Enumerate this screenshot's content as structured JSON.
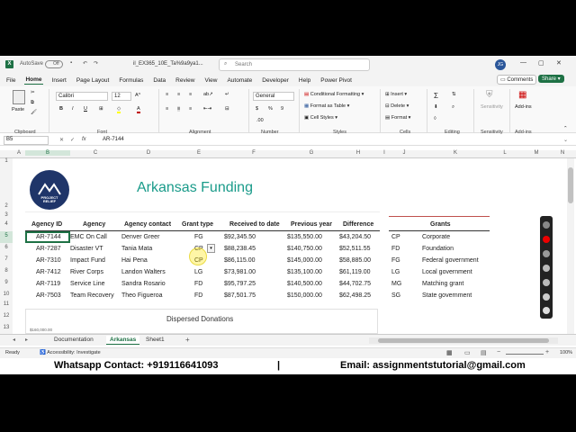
{
  "app": {
    "autosave": "AutoSave",
    "autosave_state": "Off",
    "filename": "il_EX365_10E_Ta%9a9ya1...",
    "search_placeholder": "Search",
    "user_initials": "JG"
  },
  "menu": [
    "File",
    "Home",
    "Insert",
    "Page Layout",
    "Formulas",
    "Data",
    "Review",
    "View",
    "Automate",
    "Developer",
    "Help",
    "Power Pivot"
  ],
  "menu_active": "Home",
  "actions": {
    "comments": "Comments",
    "share": "Share"
  },
  "ribbon": {
    "clipboard": {
      "paste": "Paste",
      "label": "Clipboard"
    },
    "font": {
      "name": "Calibri",
      "size": "12",
      "label": "Font"
    },
    "alignment": {
      "label": "Alignment"
    },
    "number": {
      "format": "General",
      "label": "Number"
    },
    "styles": {
      "conditional": "Conditional Formatting",
      "table": "Format as Table",
      "cell": "Cell Styles",
      "label": "Styles"
    },
    "cells": {
      "insert": "Insert",
      "delete": "Delete",
      "format": "Format",
      "label": "Cells"
    },
    "editing": {
      "label": "Editing"
    },
    "sensitivity": {
      "btn": "Sensitivity",
      "label": "Sensitivity"
    },
    "addins": {
      "btn": "Add-ins",
      "label": "Add-ins"
    }
  },
  "formula_bar": {
    "name_box": "B5",
    "fx": "fx",
    "value": "AR-7144"
  },
  "columns": [
    "A",
    "B",
    "C",
    "D",
    "E",
    "F",
    "G",
    "H",
    "I",
    "J",
    "K",
    "L",
    "M",
    "N"
  ],
  "rows": [
    "1",
    "2",
    "3",
    "4",
    "5",
    "6",
    "7",
    "8",
    "9",
    "10",
    "11",
    "12",
    "13"
  ],
  "sheet": {
    "title": "Arkansas Funding",
    "logo_text": "PROJECT RELIEF",
    "headers": [
      "Agency ID",
      "Agency",
      "Agency contact",
      "Grant type",
      "Received to date",
      "Previous year",
      "Difference"
    ],
    "data": [
      [
        "AR-7144",
        "EMC On Call",
        "Denver Greer",
        "FG",
        "$92,345.50",
        "$135,550.00",
        "$43,204.50"
      ],
      [
        "AR-7287",
        "Disaster VT",
        "Tania Mata",
        "CP",
        "$88,238.45",
        "$140,750.00",
        "$52,511.55"
      ],
      [
        "AR-7310",
        "Impact Fund",
        "Hai Pena",
        "CP",
        "$86,115.00",
        "$145,000.00",
        "$58,885.00"
      ],
      [
        "AR-7412",
        "River Corps",
        "Landon Walters",
        "LG",
        "$73,981.00",
        "$135,100.00",
        "$61,119.00"
      ],
      [
        "AR-7119",
        "Service Line",
        "Sandra Rosario",
        "FD",
        "$95,797.25",
        "$140,500.00",
        "$44,702.75"
      ],
      [
        "AR-7503",
        "Team Recovery",
        "Theo Figueroa",
        "FD",
        "$87,501.75",
        "$150,000.00",
        "$62,498.25"
      ]
    ],
    "grants_header": "Grants",
    "grants": [
      [
        "CP",
        "Corporate"
      ],
      [
        "FD",
        "Foundation"
      ],
      [
        "FG",
        "Federal government"
      ],
      [
        "LG",
        "Local government"
      ],
      [
        "MG",
        "Matching grant"
      ],
      [
        "SG",
        "State government"
      ]
    ],
    "chart_title": "Dispersed Donations",
    "chart_axis_top": "$160,000.00"
  },
  "tabs": [
    "Documentation",
    "Arkansas",
    "Sheet1"
  ],
  "tab_active": "Arkansas",
  "status": {
    "ready": "Ready",
    "accessibility": "Accessibility: Investigate",
    "zoom": "100%"
  },
  "contact": {
    "whatsapp": "Whatsapp Contact: +919116641093",
    "separator": "|",
    "email": "Email: assignmentstutorial@gmail.com"
  },
  "colors": {
    "excel_green": "#1e7145",
    "title_teal": "#1a9b8a",
    "logo_navy": "#1f3569",
    "chart_rule": "#c0504d"
  }
}
